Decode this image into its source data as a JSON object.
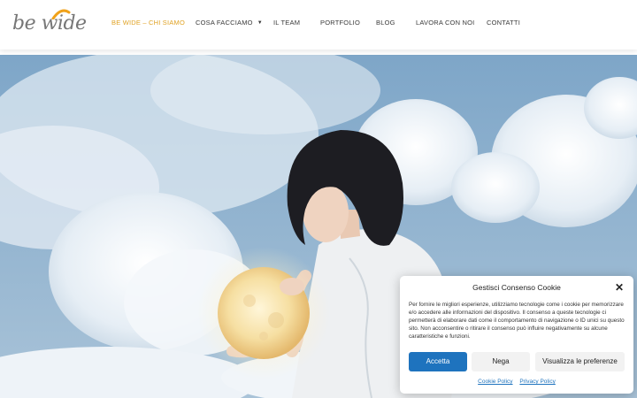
{
  "logo": {
    "text": "be wide"
  },
  "nav": {
    "items": [
      {
        "label": "BE WIDE – CHI SIAMO",
        "active": true
      },
      {
        "label": "COSA FACCIAMO",
        "has_dropdown": true
      },
      {
        "label": "IL TEAM"
      },
      {
        "label": "PORTFOLIO"
      },
      {
        "label": "BLOG"
      },
      {
        "label": "LAVORA CON NOI"
      },
      {
        "label": "CONTATTI"
      }
    ]
  },
  "colors": {
    "accent": "#e0a224",
    "button_primary": "#1e73be",
    "link": "#1e73be"
  },
  "hero": {
    "image_icon": "woman-holding-moon-lamp-among-clouds"
  },
  "cookie": {
    "title": "Gestisci Consenso Cookie",
    "close_icon": "close-icon",
    "body": "Per fornire le migliori esperienze, utilizziamo tecnologie come i cookie per memorizzare e/o accedere alle informazioni del dispositivo. Il consenso a queste tecnologie ci permetterà di elaborare dati come il comportamento di navigazione o ID unici su questo sito. Non acconsentire o ritirare il consenso può influire negativamente su alcune caratteristiche e funzioni.",
    "accept_label": "Accetta",
    "deny_label": "Nega",
    "preferences_label": "Visualizza le preferenze",
    "cookie_policy_label": "Cookie Policy",
    "privacy_policy_label": "Privacy Policy"
  }
}
